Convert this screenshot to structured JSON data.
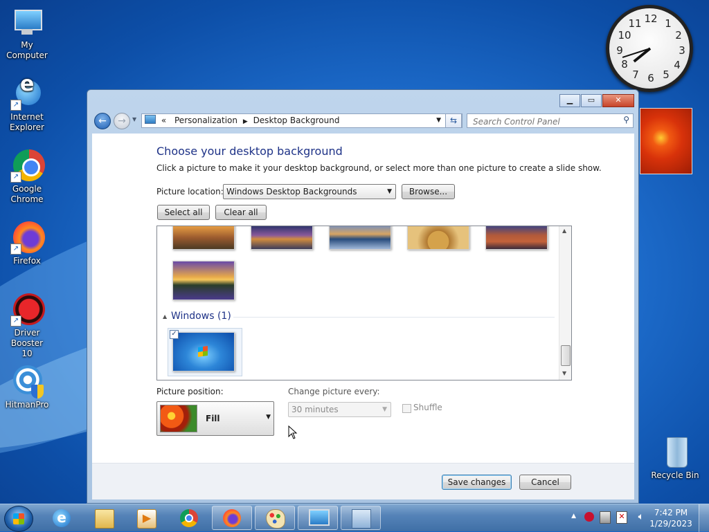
{
  "desktop": {
    "icons": [
      {
        "label_line1": "My Computer",
        "label_line2": ""
      },
      {
        "label_line1": "Internet",
        "label_line2": "Explorer"
      },
      {
        "label_line1": "Google",
        "label_line2": "Chrome"
      },
      {
        "label_line1": "Firefox",
        "label_line2": ""
      },
      {
        "label_line1": "Driver Booster",
        "label_line2": "10"
      },
      {
        "label_line1": "HitmanPro",
        "label_line2": ""
      },
      {
        "label_line1": "Recycle Bin",
        "label_line2": ""
      }
    ],
    "clock_numbers": [
      "12",
      "1",
      "2",
      "3",
      "4",
      "5",
      "6",
      "7",
      "8",
      "9",
      "10",
      "11"
    ],
    "clock_time": {
      "hours": 7,
      "minutes": 42
    }
  },
  "window": {
    "breadcrumb": {
      "root_symbol": "«",
      "items": [
        "Personalization",
        "Desktop Background"
      ]
    },
    "search_placeholder": "Search Control Panel",
    "heading": "Choose your desktop background",
    "subtitle": "Click a picture to make it your desktop background, or select more than one picture to create a slide show.",
    "picture_location_label": "Picture location:",
    "picture_location_value": "Windows Desktop Backgrounds",
    "browse_label": "Browse...",
    "select_all_label": "Select all",
    "clear_all_label": "Clear all",
    "group_windows_label": "Windows (1)",
    "picture_position_label": "Picture position:",
    "picture_position_value": "Fill",
    "change_picture_label": "Change picture every:",
    "change_picture_value": "30 minutes",
    "shuffle_label": "Shuffle",
    "save_label": "Save changes",
    "cancel_label": "Cancel"
  },
  "taskbar": {
    "time": "7:42 PM",
    "date": "1/29/2023"
  },
  "colors": {
    "heading": "#1e3287",
    "group_heading": "#1e3287",
    "taskbar": "#3f6fa6",
    "desktop": "#1f6fcf"
  }
}
